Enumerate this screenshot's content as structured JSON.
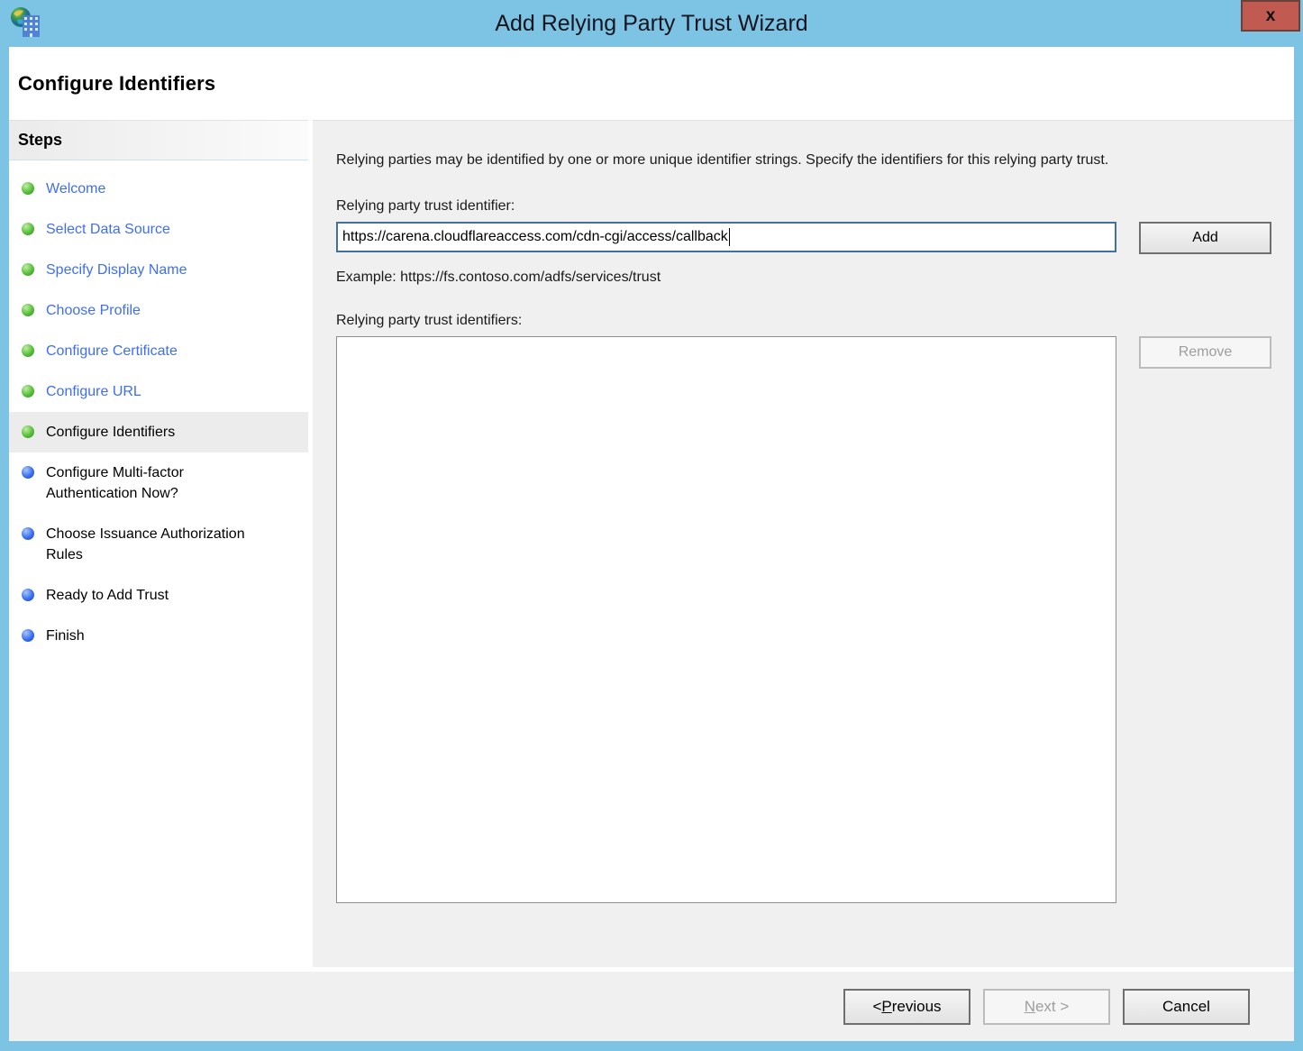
{
  "window": {
    "title": "Add Relying Party Trust Wizard",
    "close": "x"
  },
  "page": {
    "heading": "Configure Identifiers"
  },
  "sidebar": {
    "title": "Steps",
    "items": [
      {
        "label": "Welcome",
        "status": "completed"
      },
      {
        "label": "Select Data Source",
        "status": "completed"
      },
      {
        "label": "Specify Display Name",
        "status": "completed"
      },
      {
        "label": "Choose Profile",
        "status": "completed"
      },
      {
        "label": "Configure Certificate",
        "status": "completed"
      },
      {
        "label": "Configure URL",
        "status": "completed"
      },
      {
        "label": "Configure Identifiers",
        "status": "current"
      },
      {
        "label": "Configure Multi-factor Authentication Now?",
        "status": "upcoming"
      },
      {
        "label": "Choose Issuance Authorization Rules",
        "status": "upcoming"
      },
      {
        "label": "Ready to Add Trust",
        "status": "upcoming"
      },
      {
        "label": "Finish",
        "status": "upcoming"
      }
    ]
  },
  "main": {
    "description": "Relying parties may be identified by one or more unique identifier strings. Specify the identifiers for this relying party trust.",
    "identifier_label": "Relying party trust identifier:",
    "identifier_value": "https://carena.cloudflareaccess.com/cdn-cgi/access/callback",
    "add_label": "Add",
    "example": "Example: https://fs.contoso.com/adfs/services/trust",
    "identifiers_label": "Relying party trust identifiers:",
    "identifiers": [],
    "remove_label": "Remove"
  },
  "footer": {
    "previous": {
      "pre": "< ",
      "key": "P",
      "rest": "revious"
    },
    "next": {
      "pre": "",
      "key": "N",
      "rest": "ext >"
    },
    "cancel": "Cancel"
  },
  "colors": {
    "titlebar": "#7dc3e3",
    "close_button": "#c15b52",
    "link": "#3f6ef5",
    "completed_dot": "#56bf3a",
    "upcoming_dot": "#3a6ff0",
    "current_step_bg": "#ececec",
    "panel_bg": "#f0f0f0",
    "focused_input_border": "#43709d"
  }
}
